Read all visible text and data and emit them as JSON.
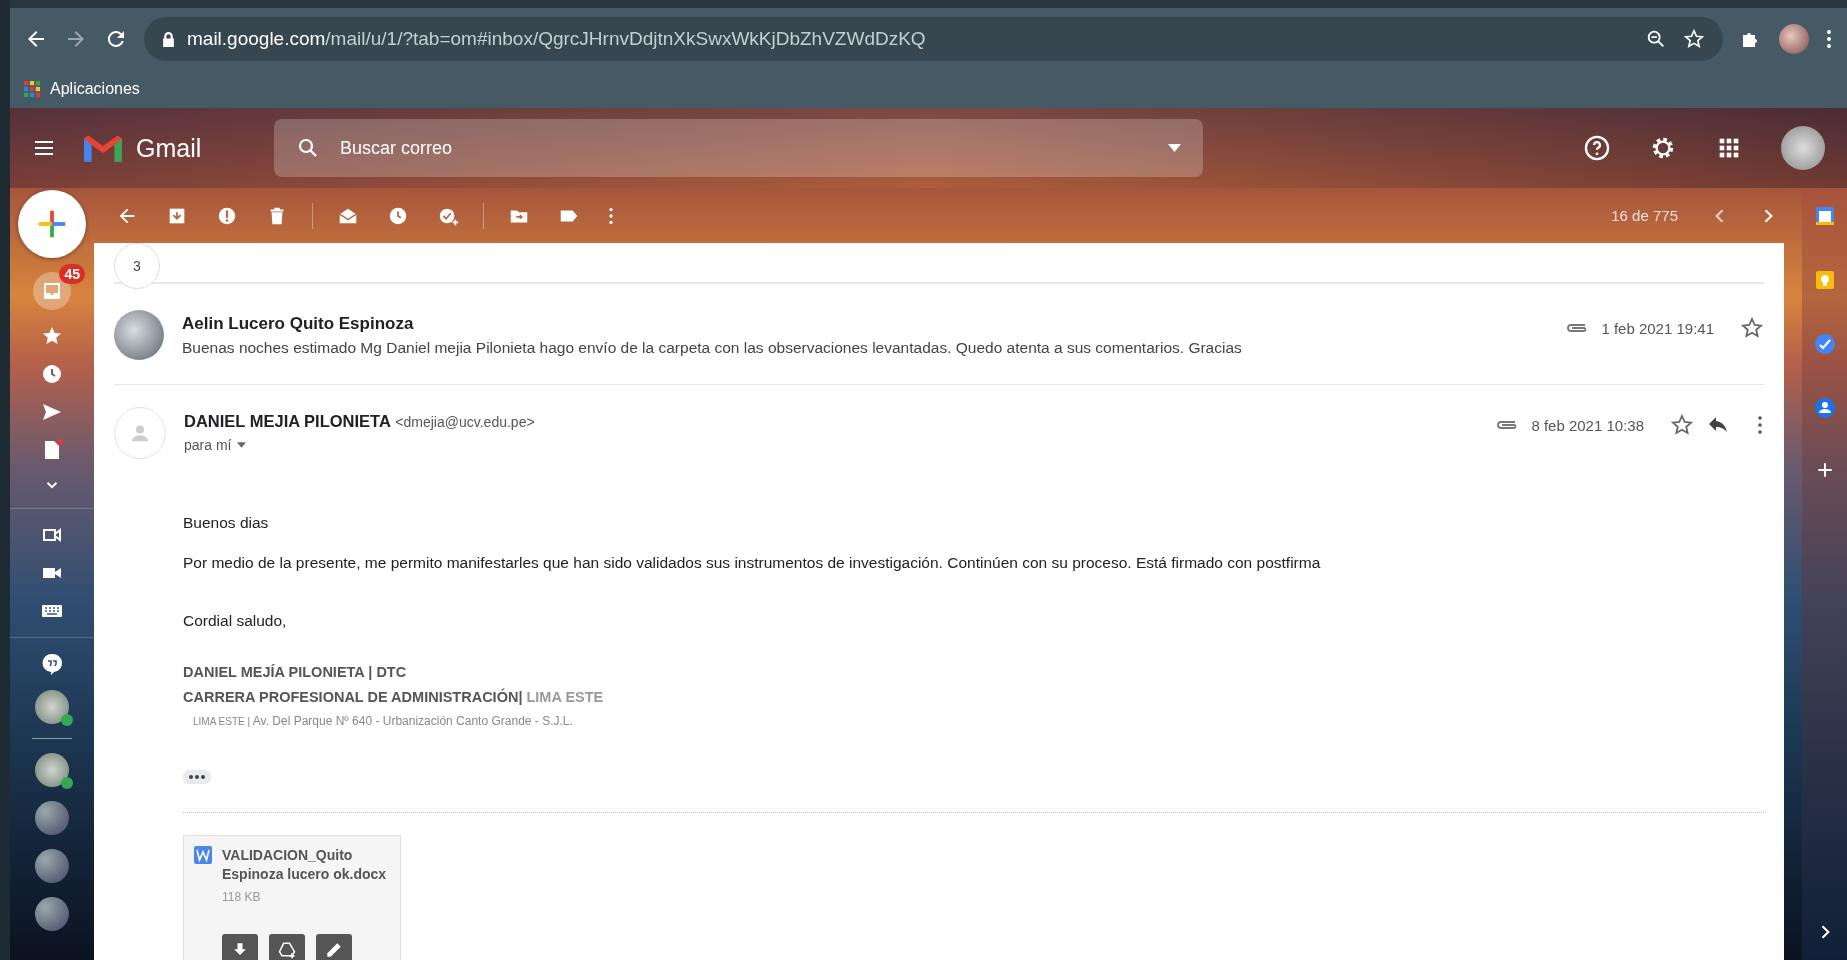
{
  "browser": {
    "url_host": "mail.google.com",
    "url_path": "/mail/u/1/?tab=om#inbox/QgrcJHrnvDdjtnXkSwxWkKjDbZhVZWdDzKQ",
    "bookmarks": [
      "Aplicaciones"
    ]
  },
  "header": {
    "app_name": "Gmail",
    "search_placeholder": "Buscar correo"
  },
  "toolbar": {
    "pager": "16 de 775"
  },
  "left_rail": {
    "inbox_badge": "45"
  },
  "thread": {
    "collapsed_count": "3",
    "collapsed_message": {
      "sender": "Aelin Lucero Quito Espinoza",
      "snippet": "Buenas noches estimado Mg Daniel mejia Pilonieta hago envío de la carpeta con las observaciones levantadas. Quedo atenta a sus comentarios. Gracias",
      "date": "1 feb 2021 19:41"
    },
    "open_message": {
      "sender": "DANIEL MEJIA PILONIETA",
      "email": "<dmejia@ucv.edu.pe>",
      "recipient": "para mí",
      "date": "8 feb 2021 10:38",
      "body": [
        "Buenos dias",
        "Por medio de la presente, me permito manifestarles que han sido validados sus instrumentos de investigación. Continúen con su proceso. Está firmado con postfirma",
        "Cordial saludo,"
      ],
      "signature": {
        "line_1": "DANIEL MEJÍA PILONIETA | DTC",
        "line_2": "CARRERA PROFESIONAL DE ADMINISTRACIÓN|",
        "line_2_campus": "LIMA ESTE",
        "line_3_campus": "LIMA ESTE |",
        "line_3_address": "Av. Del Parque Nº 640 - Urbanización Canto Grande - S.J.L."
      },
      "attachment": {
        "name": "VALIDACION_Quito Espinoza lucero ok.docx",
        "size": "118 KB"
      }
    }
  }
}
